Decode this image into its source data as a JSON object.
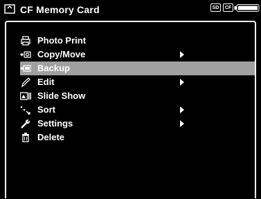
{
  "header": {
    "title": "CF Memory Card",
    "badges": [
      "SD",
      "CF"
    ]
  },
  "menu": {
    "items": [
      {
        "label": "Photo Print",
        "icon": "printer-icon",
        "submenu": false
      },
      {
        "label": "Copy/Move",
        "icon": "copy-icon",
        "submenu": true
      },
      {
        "label": "Backup",
        "icon": "backup-icon",
        "submenu": false,
        "selected": true
      },
      {
        "label": "Edit",
        "icon": "pencil-icon",
        "submenu": true
      },
      {
        "label": "Slide Show",
        "icon": "slideshow-icon",
        "submenu": false
      },
      {
        "label": "Sort",
        "icon": "sort-icon",
        "submenu": true
      },
      {
        "label": "Settings",
        "icon": "wrench-icon",
        "submenu": true
      },
      {
        "label": "Delete",
        "icon": "trash-icon",
        "submenu": false
      }
    ],
    "selected_bg": "#a0a0a0"
  },
  "battery": {
    "level": 1.0
  }
}
